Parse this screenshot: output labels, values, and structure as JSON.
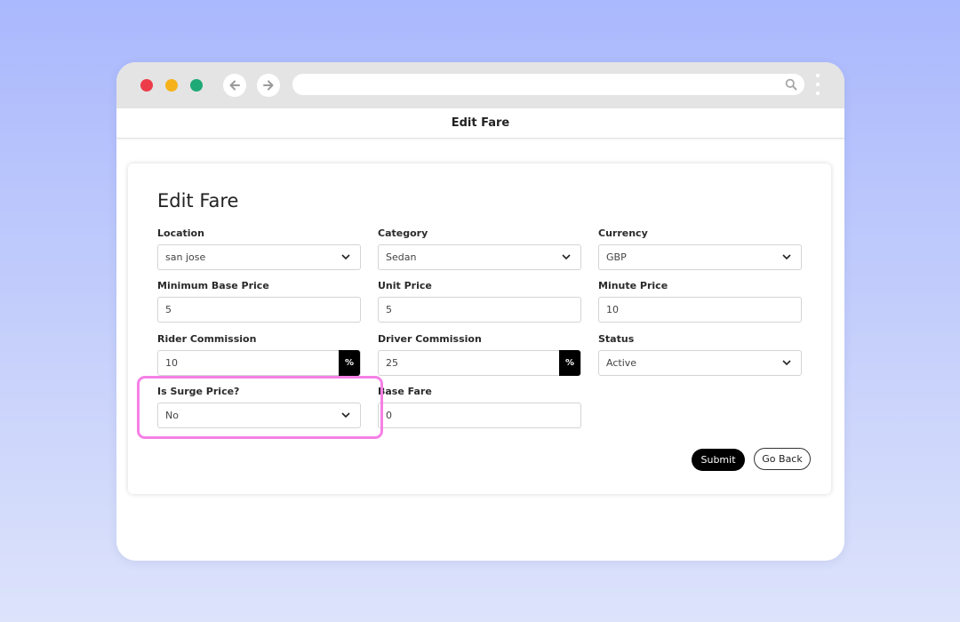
{
  "page": {
    "header_title": "Edit Fare"
  },
  "form": {
    "title": "Edit Fare",
    "fields": {
      "location": {
        "label": "Location",
        "value": "san jose"
      },
      "category": {
        "label": "Category",
        "value": "Sedan"
      },
      "currency": {
        "label": "Currency",
        "value": "GBP"
      },
      "min_base_price": {
        "label": "Minimum Base Price",
        "value": "5"
      },
      "unit_price": {
        "label": "Unit Price",
        "value": "5"
      },
      "minute_price": {
        "label": "Minute Price",
        "value": "10"
      },
      "rider_commission": {
        "label": "Rider Commission",
        "value": "10",
        "suffix": "%"
      },
      "driver_commission": {
        "label": "Driver Commission",
        "value": "25",
        "suffix": "%"
      },
      "status": {
        "label": "Status",
        "value": "Active"
      },
      "is_surge_price": {
        "label": "Is Surge Price?",
        "value": "No"
      },
      "base_fare": {
        "label": "Base Fare",
        "value": "0"
      }
    },
    "actions": {
      "submit_label": "Submit",
      "back_label": "Go Back"
    }
  },
  "colors": {
    "accent": "#000000",
    "highlight": "#f580e6",
    "dot_red": "#ec3c4a",
    "dot_yellow": "#f5b21a",
    "dot_green": "#1ea976"
  },
  "icons": [
    "back-arrow-icon",
    "forward-arrow-icon",
    "search-icon",
    "kebab-menu-icon",
    "chevron-down-icon"
  ]
}
